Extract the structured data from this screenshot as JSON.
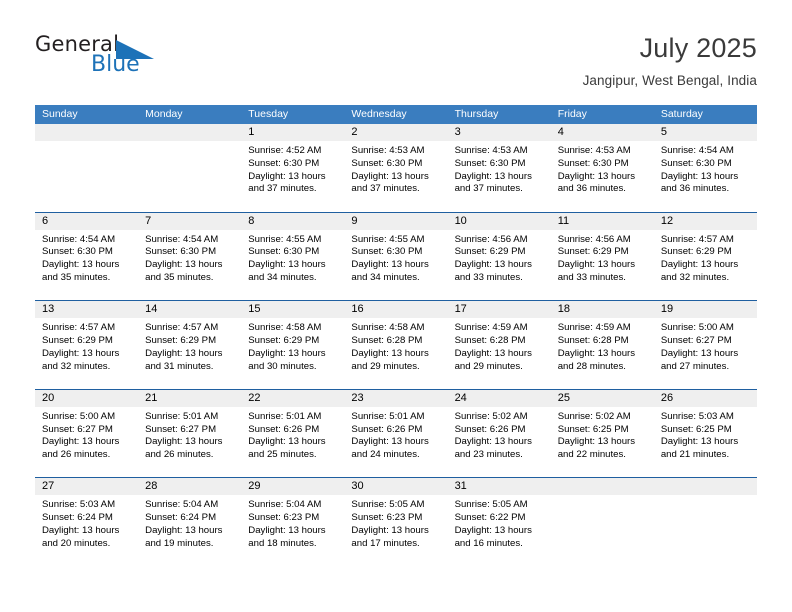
{
  "brand": {
    "name_top": "General",
    "name_bottom": "Blue",
    "triangle_icon": "triangle-icon",
    "accent_color": "#1d72b8"
  },
  "header": {
    "title": "July 2025",
    "subtitle": "Jangipur, West Bengal, India"
  },
  "calendar": {
    "header_bg": "#3a7dbf",
    "row_divider": "#1f5fa0",
    "numband_bg": "#efefef",
    "weekdays": [
      "Sunday",
      "Monday",
      "Tuesday",
      "Wednesday",
      "Thursday",
      "Friday",
      "Saturday"
    ],
    "weeks": [
      [
        {
          "day": "",
          "info": ""
        },
        {
          "day": "",
          "info": ""
        },
        {
          "day": "1",
          "info": "Sunrise: 4:52 AM\nSunset: 6:30 PM\nDaylight: 13 hours\nand 37 minutes."
        },
        {
          "day": "2",
          "info": "Sunrise: 4:53 AM\nSunset: 6:30 PM\nDaylight: 13 hours\nand 37 minutes."
        },
        {
          "day": "3",
          "info": "Sunrise: 4:53 AM\nSunset: 6:30 PM\nDaylight: 13 hours\nand 37 minutes."
        },
        {
          "day": "4",
          "info": "Sunrise: 4:53 AM\nSunset: 6:30 PM\nDaylight: 13 hours\nand 36 minutes."
        },
        {
          "day": "5",
          "info": "Sunrise: 4:54 AM\nSunset: 6:30 PM\nDaylight: 13 hours\nand 36 minutes."
        }
      ],
      [
        {
          "day": "6",
          "info": "Sunrise: 4:54 AM\nSunset: 6:30 PM\nDaylight: 13 hours\nand 35 minutes."
        },
        {
          "day": "7",
          "info": "Sunrise: 4:54 AM\nSunset: 6:30 PM\nDaylight: 13 hours\nand 35 minutes."
        },
        {
          "day": "8",
          "info": "Sunrise: 4:55 AM\nSunset: 6:30 PM\nDaylight: 13 hours\nand 34 minutes."
        },
        {
          "day": "9",
          "info": "Sunrise: 4:55 AM\nSunset: 6:30 PM\nDaylight: 13 hours\nand 34 minutes."
        },
        {
          "day": "10",
          "info": "Sunrise: 4:56 AM\nSunset: 6:29 PM\nDaylight: 13 hours\nand 33 minutes."
        },
        {
          "day": "11",
          "info": "Sunrise: 4:56 AM\nSunset: 6:29 PM\nDaylight: 13 hours\nand 33 minutes."
        },
        {
          "day": "12",
          "info": "Sunrise: 4:57 AM\nSunset: 6:29 PM\nDaylight: 13 hours\nand 32 minutes."
        }
      ],
      [
        {
          "day": "13",
          "info": "Sunrise: 4:57 AM\nSunset: 6:29 PM\nDaylight: 13 hours\nand 32 minutes."
        },
        {
          "day": "14",
          "info": "Sunrise: 4:57 AM\nSunset: 6:29 PM\nDaylight: 13 hours\nand 31 minutes."
        },
        {
          "day": "15",
          "info": "Sunrise: 4:58 AM\nSunset: 6:29 PM\nDaylight: 13 hours\nand 30 minutes."
        },
        {
          "day": "16",
          "info": "Sunrise: 4:58 AM\nSunset: 6:28 PM\nDaylight: 13 hours\nand 29 minutes."
        },
        {
          "day": "17",
          "info": "Sunrise: 4:59 AM\nSunset: 6:28 PM\nDaylight: 13 hours\nand 29 minutes."
        },
        {
          "day": "18",
          "info": "Sunrise: 4:59 AM\nSunset: 6:28 PM\nDaylight: 13 hours\nand 28 minutes."
        },
        {
          "day": "19",
          "info": "Sunrise: 5:00 AM\nSunset: 6:27 PM\nDaylight: 13 hours\nand 27 minutes."
        }
      ],
      [
        {
          "day": "20",
          "info": "Sunrise: 5:00 AM\nSunset: 6:27 PM\nDaylight: 13 hours\nand 26 minutes."
        },
        {
          "day": "21",
          "info": "Sunrise: 5:01 AM\nSunset: 6:27 PM\nDaylight: 13 hours\nand 26 minutes."
        },
        {
          "day": "22",
          "info": "Sunrise: 5:01 AM\nSunset: 6:26 PM\nDaylight: 13 hours\nand 25 minutes."
        },
        {
          "day": "23",
          "info": "Sunrise: 5:01 AM\nSunset: 6:26 PM\nDaylight: 13 hours\nand 24 minutes."
        },
        {
          "day": "24",
          "info": "Sunrise: 5:02 AM\nSunset: 6:26 PM\nDaylight: 13 hours\nand 23 minutes."
        },
        {
          "day": "25",
          "info": "Sunrise: 5:02 AM\nSunset: 6:25 PM\nDaylight: 13 hours\nand 22 minutes."
        },
        {
          "day": "26",
          "info": "Sunrise: 5:03 AM\nSunset: 6:25 PM\nDaylight: 13 hours\nand 21 minutes."
        }
      ],
      [
        {
          "day": "27",
          "info": "Sunrise: 5:03 AM\nSunset: 6:24 PM\nDaylight: 13 hours\nand 20 minutes."
        },
        {
          "day": "28",
          "info": "Sunrise: 5:04 AM\nSunset: 6:24 PM\nDaylight: 13 hours\nand 19 minutes."
        },
        {
          "day": "29",
          "info": "Sunrise: 5:04 AM\nSunset: 6:23 PM\nDaylight: 13 hours\nand 18 minutes."
        },
        {
          "day": "30",
          "info": "Sunrise: 5:05 AM\nSunset: 6:23 PM\nDaylight: 13 hours\nand 17 minutes."
        },
        {
          "day": "31",
          "info": "Sunrise: 5:05 AM\nSunset: 6:22 PM\nDaylight: 13 hours\nand 16 minutes."
        },
        {
          "day": "",
          "info": ""
        },
        {
          "day": "",
          "info": ""
        }
      ]
    ]
  }
}
